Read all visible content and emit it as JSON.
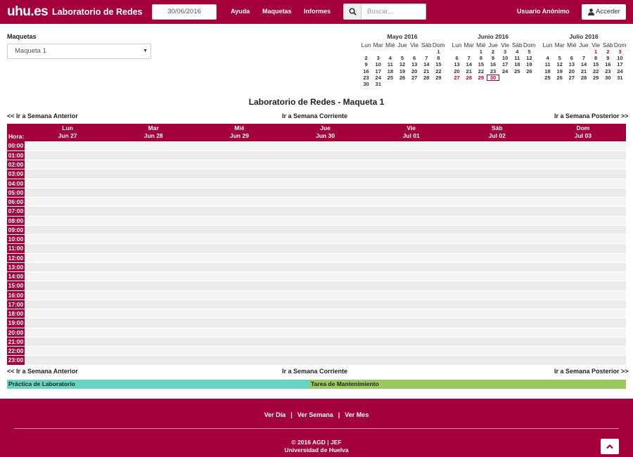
{
  "header": {
    "logo": "uhu.es",
    "brand": "Laboratorio de Redes",
    "date_value": "30/06/2016",
    "nav": [
      "Ayuda",
      "Maquetas",
      "Informes"
    ],
    "search_placeholder": "Buscar...",
    "user": "Usuario Anónimo",
    "login_label": "Acceder"
  },
  "maquetas": {
    "label": "Maquetas",
    "selected": "Maqueta 1"
  },
  "mini_calendars": [
    {
      "title": "Mayo 2016",
      "weekdays": [
        "Lun",
        "Mar",
        "Mié",
        "Jue",
        "Vie",
        "Sáb",
        "Dom"
      ],
      "weeks": [
        [
          "",
          "",
          "",
          "",
          "",
          "",
          "1"
        ],
        [
          "2",
          "3",
          "4",
          "5",
          "6",
          "7",
          "8"
        ],
        [
          "9",
          "10",
          "11",
          "12",
          "13",
          "14",
          "15"
        ],
        [
          "16",
          "17",
          "18",
          "19",
          "20",
          "21",
          "22"
        ],
        [
          "23",
          "24",
          "25",
          "26",
          "27",
          "28",
          "29"
        ],
        [
          "30",
          "31",
          "",
          "",
          "",
          "",
          ""
        ]
      ],
      "red_days": [],
      "today": ""
    },
    {
      "title": "Junio 2016",
      "weekdays": [
        "Lun",
        "Mar",
        "Mié",
        "Jue",
        "Vie",
        "Sáb",
        "Dom"
      ],
      "weeks": [
        [
          "",
          "",
          "1",
          "2",
          "3",
          "4",
          "5"
        ],
        [
          "6",
          "7",
          "8",
          "9",
          "10",
          "11",
          "12"
        ],
        [
          "13",
          "14",
          "15",
          "16",
          "17",
          "18",
          "19"
        ],
        [
          "20",
          "21",
          "22",
          "23",
          "24",
          "25",
          "26"
        ],
        [
          "27",
          "28",
          "29",
          "30",
          "",
          "",
          ""
        ]
      ],
      "red_days": [
        "27",
        "28",
        "29"
      ],
      "today": "30"
    },
    {
      "title": "Julio 2016",
      "weekdays": [
        "Lun",
        "Mar",
        "Mié",
        "Jue",
        "Vie",
        "Sáb",
        "Dom"
      ],
      "weeks": [
        [
          "",
          "",
          "",
          "",
          "1",
          "2",
          "3"
        ],
        [
          "4",
          "5",
          "6",
          "7",
          "8",
          "9",
          "10"
        ],
        [
          "11",
          "12",
          "13",
          "14",
          "15",
          "16",
          "17"
        ],
        [
          "18",
          "19",
          "20",
          "21",
          "22",
          "23",
          "24"
        ],
        [
          "25",
          "26",
          "27",
          "28",
          "29",
          "30",
          "31"
        ]
      ],
      "red_days": [
        "1",
        "2",
        "3"
      ],
      "today": ""
    }
  ],
  "title": "Laboratorio de Redes - Maqueta 1",
  "week_nav": {
    "prev": "<< Ir a Semana Anterior",
    "current": "Ir a Semana Corriente",
    "next": "Ir a Semana Posterior >>"
  },
  "schedule": {
    "hour_label": "Hora:",
    "days": [
      {
        "name": "Lun",
        "date": "Jun 27"
      },
      {
        "name": "Mar",
        "date": "Jun 28"
      },
      {
        "name": "Mié",
        "date": "Jun 29"
      },
      {
        "name": "Jue",
        "date": "Jun 30"
      },
      {
        "name": "Vie",
        "date": "Jul 01"
      },
      {
        "name": "Sáb",
        "date": "Jul 02"
      },
      {
        "name": "Dom",
        "date": "Jul 03"
      }
    ],
    "hours": [
      "00:00",
      "01:00",
      "02:00",
      "03:00",
      "04:00",
      "05:00",
      "06:00",
      "07:00",
      "08:00",
      "09:00",
      "10:00",
      "11:00",
      "12:00",
      "13:00",
      "14:00",
      "15:00",
      "16:00",
      "17:00",
      "18:00",
      "19:00",
      "20:00",
      "21:00",
      "22:00",
      "23:00"
    ]
  },
  "legend": [
    {
      "label": "Práctica de Laboratorio",
      "color": "#66d4c2"
    },
    {
      "label": "Tarea de Mantenimiento",
      "color": "#99c95c"
    }
  ],
  "footer": {
    "links": [
      "Ver Día",
      "Ver Semana",
      "Ver Mes"
    ],
    "copyright": "© 2016 AGD | JEF",
    "university": "Universidad de Huelva"
  },
  "colors": {
    "brand": "#a4003b"
  }
}
